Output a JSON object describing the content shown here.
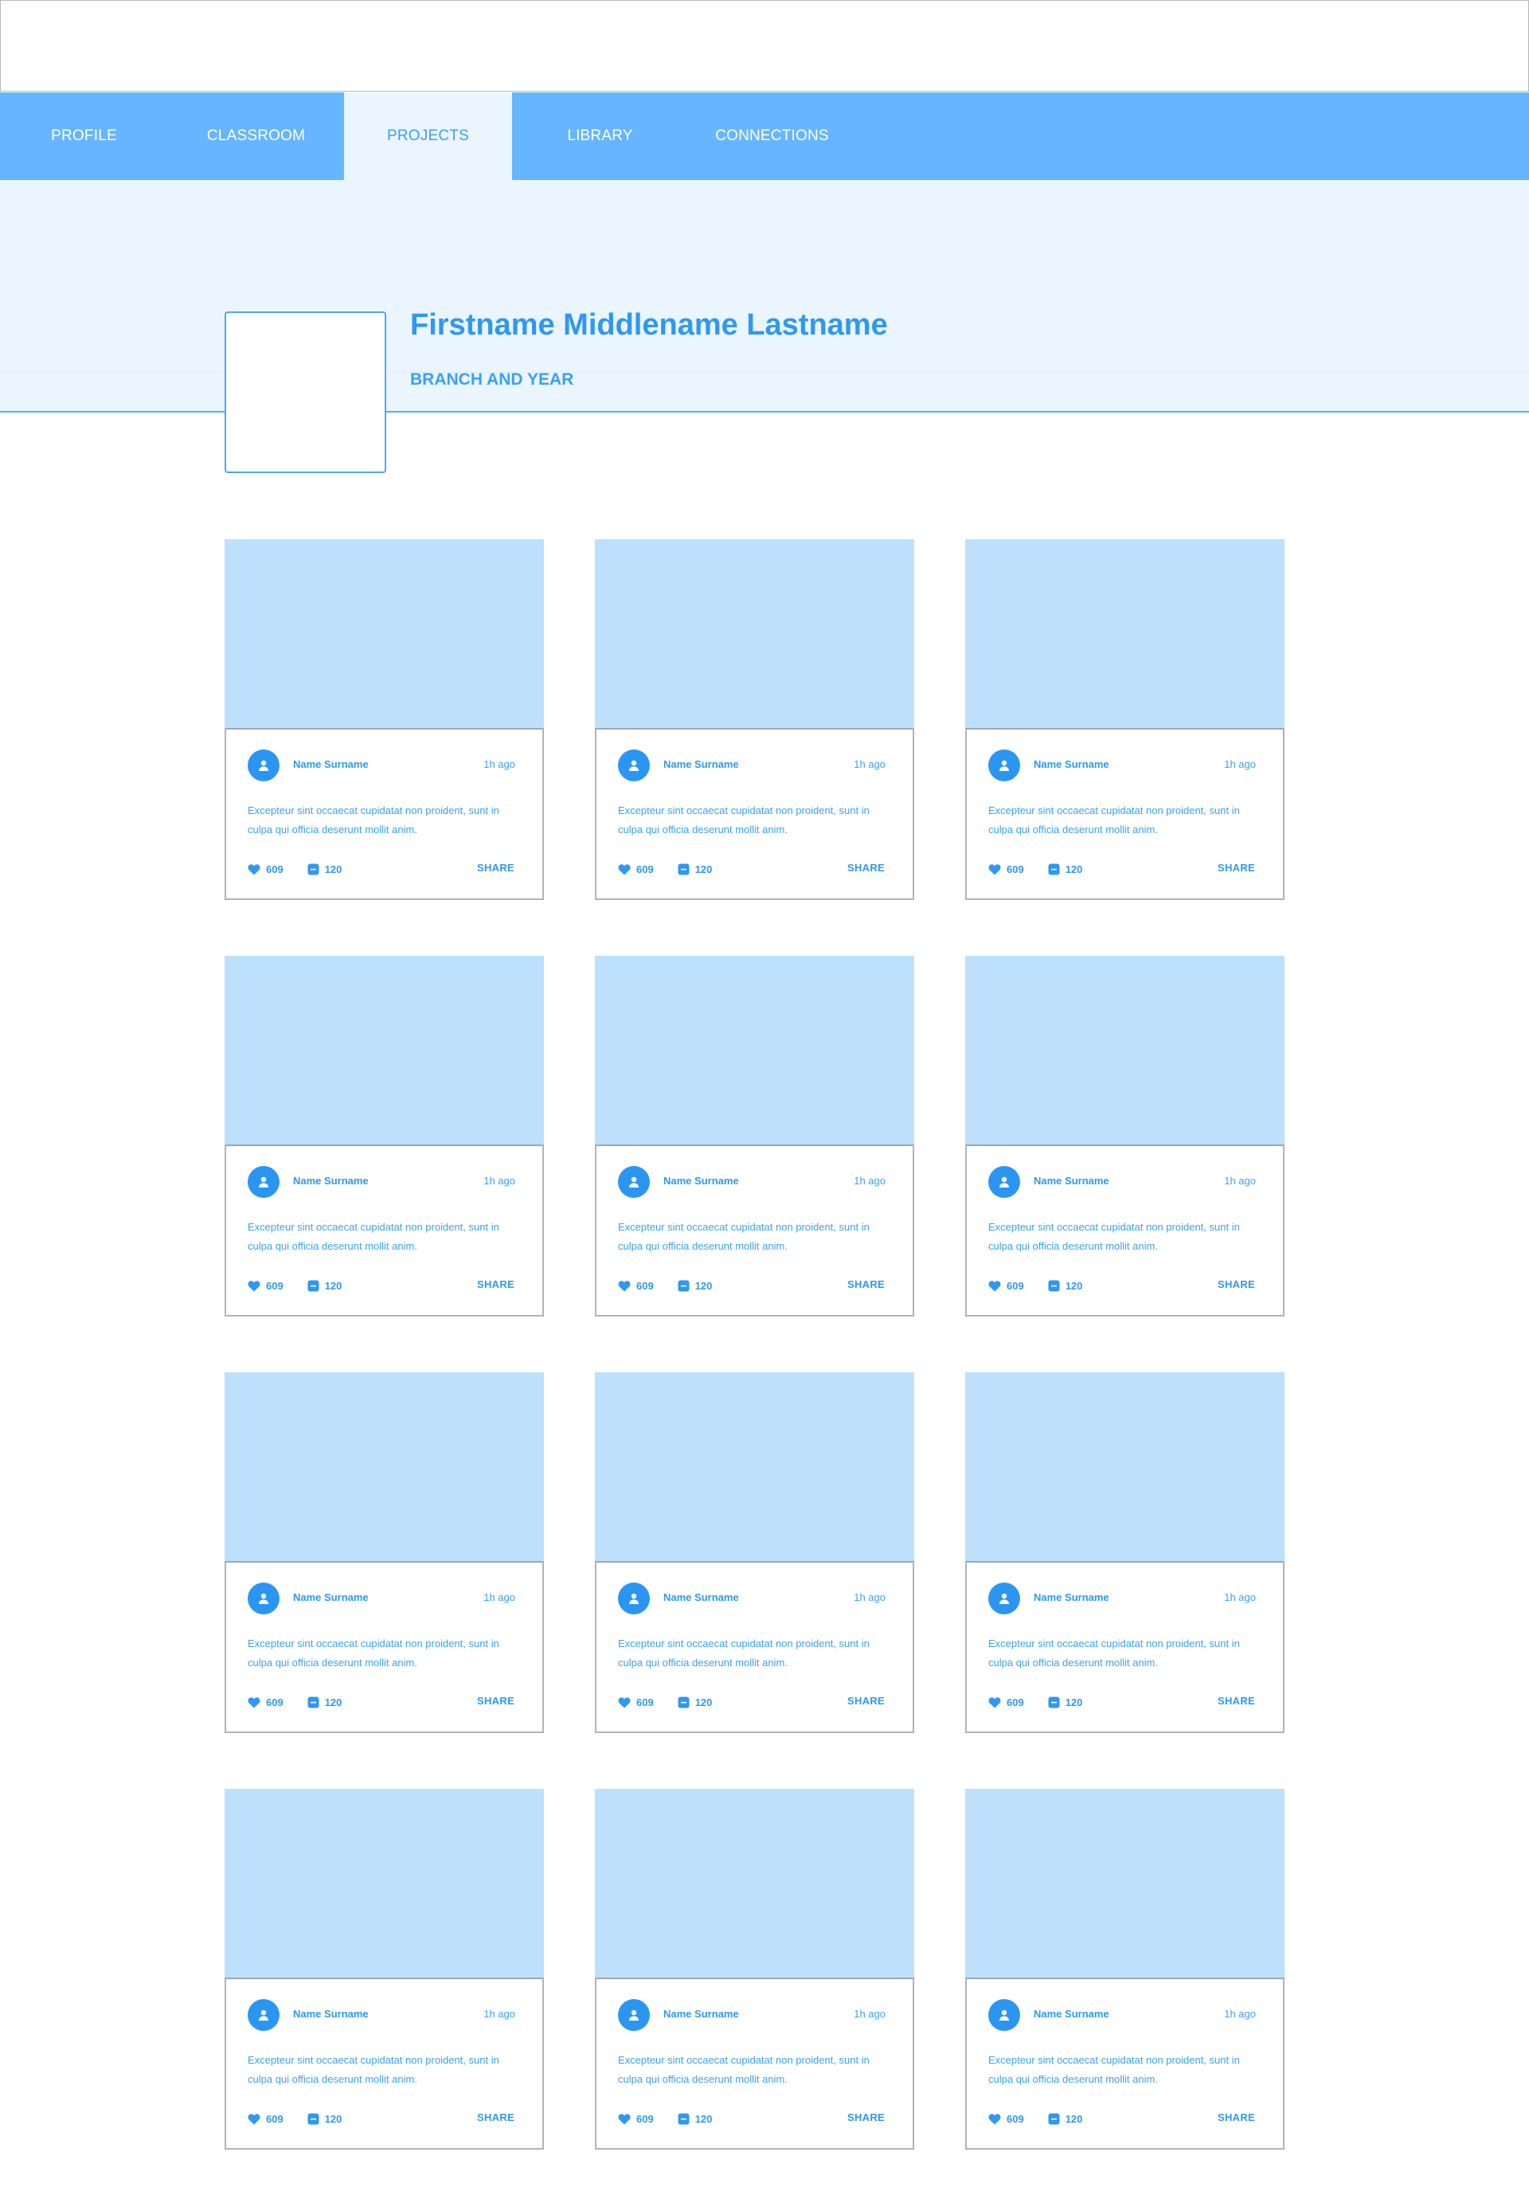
{
  "nav": {
    "tabs": [
      {
        "label": "PROFILE",
        "active": false
      },
      {
        "label": "CLASSROOM",
        "active": false
      },
      {
        "label": "PROJECTS",
        "active": true
      },
      {
        "label": "LIBRARY",
        "active": false
      },
      {
        "label": "CONNECTIONS",
        "active": false
      }
    ]
  },
  "profile": {
    "name": "Firstname Middlename Lastname",
    "subtitle": "BRANCH AND YEAR"
  },
  "colors": {
    "accent": "#2e98f2",
    "nav_bg": "#66b6ff",
    "hero_bg": "#eaf5ff",
    "card_image": "#bde0fd"
  },
  "icons": {
    "like": "heart-icon",
    "comment": "comment-icon",
    "author": "user-icon"
  },
  "cards": [
    {
      "author": "Name Surname",
      "time": "1h ago",
      "text": "Excepteur sint occaecat cupidatat non proident, sunt in culpa qui officia deserunt mollit anim.",
      "likes": "609",
      "comments": "120",
      "share": "SHARE"
    },
    {
      "author": "Name Surname",
      "time": "1h ago",
      "text": "Excepteur sint occaecat cupidatat non proident, sunt in culpa qui officia deserunt mollit anim.",
      "likes": "609",
      "comments": "120",
      "share": "SHARE"
    },
    {
      "author": "Name Surname",
      "time": "1h ago",
      "text": "Excepteur sint occaecat cupidatat non proident, sunt in culpa qui officia deserunt mollit anim.",
      "likes": "609",
      "comments": "120",
      "share": "SHARE"
    },
    {
      "author": "Name Surname",
      "time": "1h ago",
      "text": "Excepteur sint occaecat cupidatat non proident, sunt in culpa qui officia deserunt mollit anim.",
      "likes": "609",
      "comments": "120",
      "share": "SHARE"
    },
    {
      "author": "Name Surname",
      "time": "1h ago",
      "text": "Excepteur sint occaecat cupidatat non proident, sunt in culpa qui officia deserunt mollit anim.",
      "likes": "609",
      "comments": "120",
      "share": "SHARE"
    },
    {
      "author": "Name Surname",
      "time": "1h ago",
      "text": "Excepteur sint occaecat cupidatat non proident, sunt in culpa qui officia deserunt mollit anim.",
      "likes": "609",
      "comments": "120",
      "share": "SHARE"
    },
    {
      "author": "Name Surname",
      "time": "1h ago",
      "text": "Excepteur sint occaecat cupidatat non proident, sunt in culpa qui officia deserunt mollit anim.",
      "likes": "609",
      "comments": "120",
      "share": "SHARE"
    },
    {
      "author": "Name Surname",
      "time": "1h ago",
      "text": "Excepteur sint occaecat cupidatat non proident, sunt in culpa qui officia deserunt mollit anim.",
      "likes": "609",
      "comments": "120",
      "share": "SHARE"
    },
    {
      "author": "Name Surname",
      "time": "1h ago",
      "text": "Excepteur sint occaecat cupidatat non proident, sunt in culpa qui officia deserunt mollit anim.",
      "likes": "609",
      "comments": "120",
      "share": "SHARE"
    },
    {
      "author": "Name Surname",
      "time": "1h ago",
      "text": "Excepteur sint occaecat cupidatat non proident, sunt in culpa qui officia deserunt mollit anim.",
      "likes": "609",
      "comments": "120",
      "share": "SHARE"
    },
    {
      "author": "Name Surname",
      "time": "1h ago",
      "text": "Excepteur sint occaecat cupidatat non proident, sunt in culpa qui officia deserunt mollit anim.",
      "likes": "609",
      "comments": "120",
      "share": "SHARE"
    },
    {
      "author": "Name Surname",
      "time": "1h ago",
      "text": "Excepteur sint occaecat cupidatat non proident, sunt in culpa qui officia deserunt mollit anim.",
      "likes": "609",
      "comments": "120",
      "share": "SHARE"
    }
  ]
}
